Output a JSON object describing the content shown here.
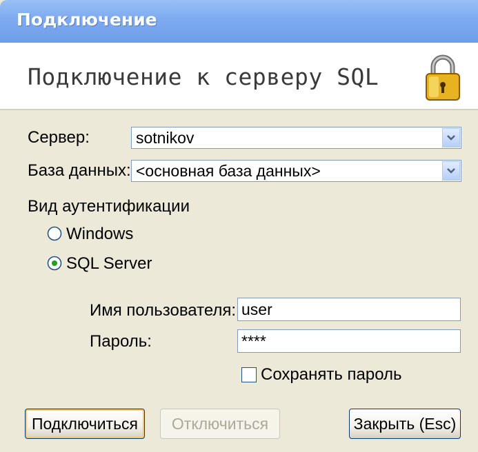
{
  "window": {
    "title": "Подключение"
  },
  "header": {
    "text": "Подключение к серверу SQL",
    "icon": "padlock-icon"
  },
  "form": {
    "server_label": "Сервер:",
    "server_value": "sotnikov",
    "database_label": "База данных:",
    "database_value": "<основная база данных>",
    "auth_group_label": "Вид аутентификации",
    "auth_options": [
      {
        "label": "Windows",
        "selected": false
      },
      {
        "label": "SQL Server",
        "selected": true
      }
    ],
    "username_label": "Имя пользователя:",
    "username_value": "user",
    "password_label": "Пароль:",
    "password_value": "****",
    "save_password_label": "Сохранять пароль",
    "save_password_checked": false
  },
  "buttons": {
    "connect": "Подключиться",
    "disconnect": "Отключиться",
    "close": "Закрыть (Esc)"
  },
  "colors": {
    "titlebar": "#7daaf0",
    "dialog_bg": "#ece9d8",
    "input_border": "#7f9db9",
    "button_border": "#003c74"
  }
}
